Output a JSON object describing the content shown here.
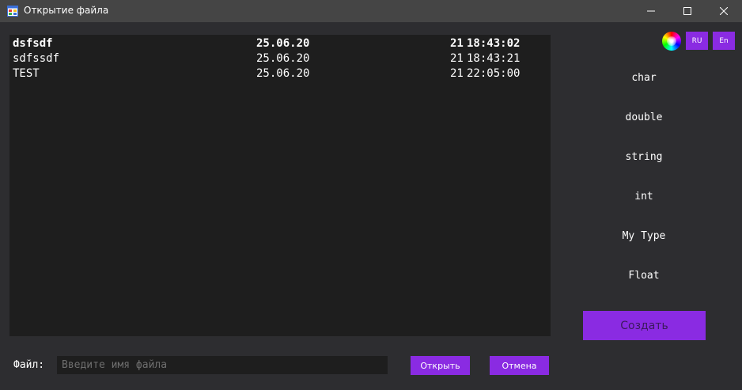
{
  "window": {
    "title": "Открытие файла",
    "icon": "app-window-icon",
    "controls": [
      "minimize-icon",
      "maximize-icon",
      "close-icon"
    ]
  },
  "files": [
    {
      "name": "dsfsdf",
      "date": "25.06.20",
      "year": "21",
      "time": "18:43:02",
      "selected": true
    },
    {
      "name": "sdfssdf",
      "date": "25.06.20",
      "year": "21",
      "time": "18:43:21",
      "selected": false
    },
    {
      "name": "TEST",
      "date": "25.06.20",
      "year": "21",
      "time": "22:05:00",
      "selected": false
    }
  ],
  "toolbar": {
    "color_icon": "color-wheel-icon",
    "lang_ru": "RU",
    "lang_en": "En"
  },
  "types": [
    "char",
    "double",
    "string",
    "int",
    "My Type",
    "Float"
  ],
  "create_label": "Создать",
  "footer": {
    "file_label": "Файл:",
    "file_placeholder": "Введите имя файла",
    "file_value": "",
    "open_label": "Открыть",
    "cancel_label": "Отмена"
  },
  "colors": {
    "background": "#2d2d30",
    "titlebar": "#454545",
    "panel": "#1e1e1e",
    "accent": "#8a2be2",
    "text": "#ffffff",
    "placeholder": "#6e6e6e"
  }
}
